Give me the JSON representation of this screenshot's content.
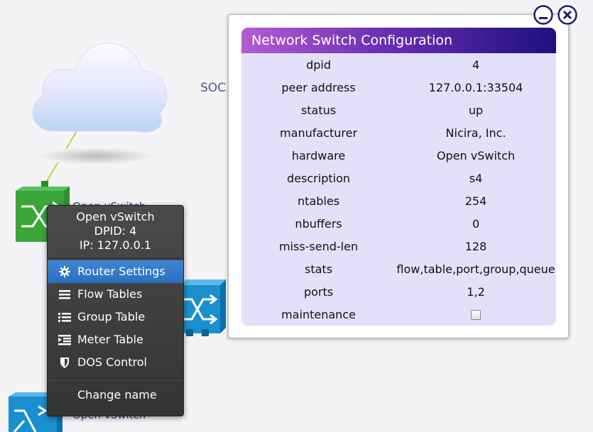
{
  "topology": {
    "soc_label": "SOC",
    "caption_behind": "Open vSwitch",
    "caption_bottom": "Open vSwitch"
  },
  "context_menu": {
    "header": {
      "line1": "Open vSwitch",
      "line2": "DPID: 4",
      "line3": "IP: 127.0.0.1"
    },
    "items": [
      {
        "label": "Router Settings",
        "icon": "gear-icon",
        "active": true
      },
      {
        "label": "Flow Tables",
        "icon": "list-icon"
      },
      {
        "label": "Group Table",
        "icon": "bullet-list-icon"
      },
      {
        "label": "Meter Table",
        "icon": "indent-list-icon"
      },
      {
        "label": "DOS Control",
        "icon": "shield-icon"
      }
    ],
    "footer_item": "Change name"
  },
  "dialog": {
    "title": "Network Switch Configuration",
    "rows": [
      {
        "key": "dpid",
        "value": "4"
      },
      {
        "key": "peer address",
        "value": "127.0.0.1:33504"
      },
      {
        "key": "status",
        "value": "up"
      },
      {
        "key": "manufacturer",
        "value": "Nicira, Inc."
      },
      {
        "key": "hardware",
        "value": "Open vSwitch"
      },
      {
        "key": "description",
        "value": "s4"
      },
      {
        "key": "ntables",
        "value": "254"
      },
      {
        "key": "nbuffers",
        "value": "0"
      },
      {
        "key": "miss-send-len",
        "value": "128"
      },
      {
        "key": "stats",
        "value": "flow,table,port,group,queue"
      },
      {
        "key": "ports",
        "value": "1,2"
      }
    ],
    "maintenance": {
      "key": "maintenance",
      "checked": false
    }
  },
  "colors": {
    "accent": "#2a6fbd",
    "title_start": "#b65bd1",
    "title_end": "#1f107c",
    "panel_bg": "#e2e1f9",
    "switch_green": "#3aa63a",
    "switch_blue": "#1a8fd0"
  }
}
